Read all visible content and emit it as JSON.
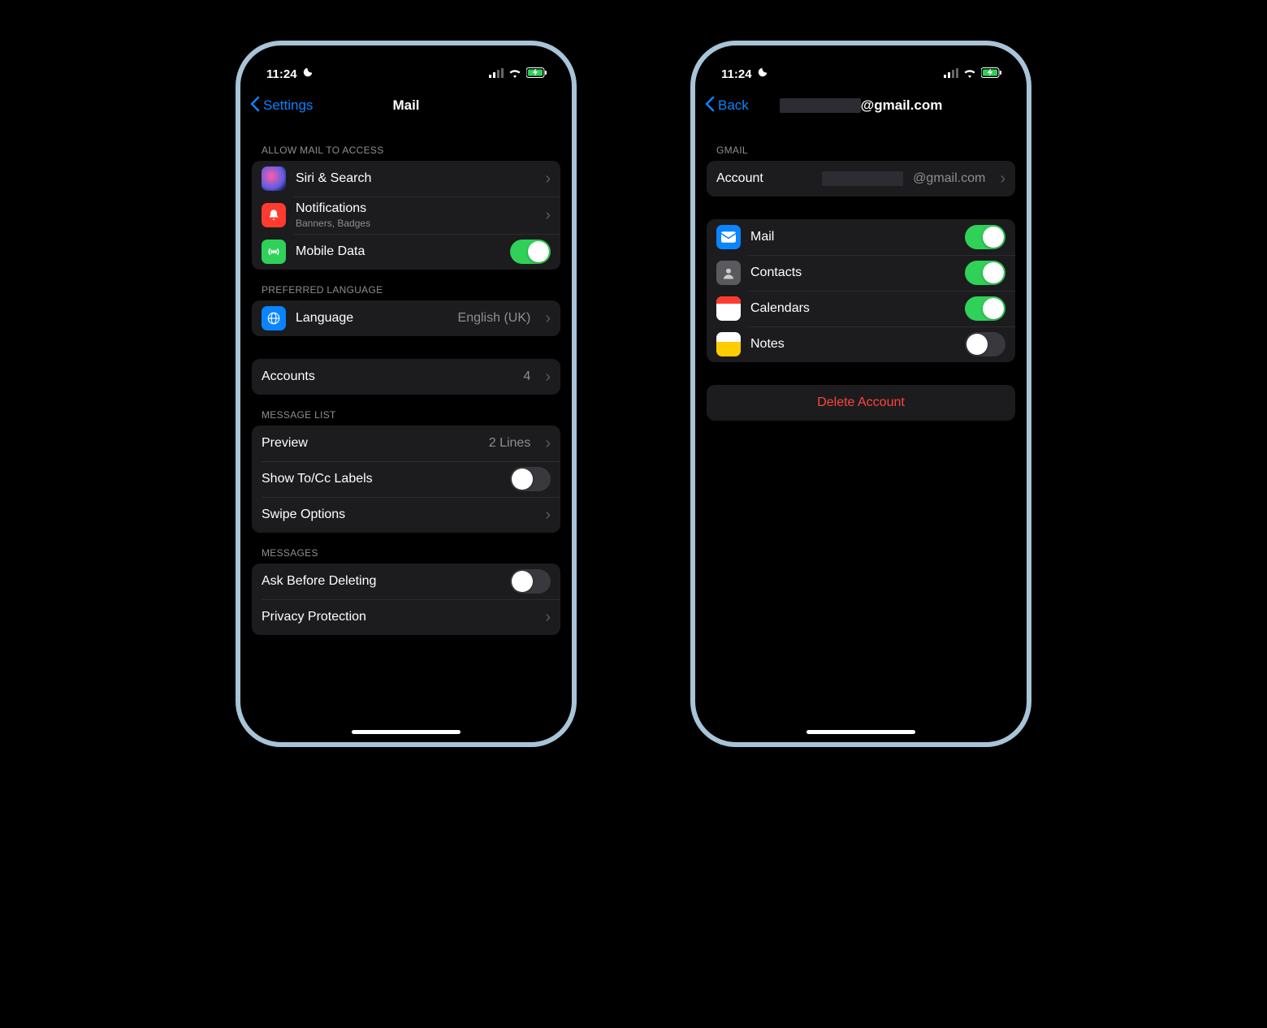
{
  "status": {
    "time": "11:24"
  },
  "left": {
    "back_label": "Settings",
    "title": "Mail",
    "sections": {
      "access_header": "ALLOW MAIL TO ACCESS",
      "siri_label": "Siri & Search",
      "notif_label": "Notifications",
      "notif_sub": "Banners, Badges",
      "mobile_label": "Mobile Data",
      "mobile_on": true,
      "pref_lang_header": "PREFERRED LANGUAGE",
      "lang_label": "Language",
      "lang_value": "English (UK)",
      "accounts_label": "Accounts",
      "accounts_count": "4",
      "msglist_header": "MESSAGE LIST",
      "preview_label": "Preview",
      "preview_value": "2 Lines",
      "showtocc_label": "Show To/Cc Labels",
      "showtocc_on": false,
      "swipe_label": "Swipe Options",
      "messages_header": "MESSAGES",
      "askdel_label": "Ask Before Deleting",
      "askdel_on": false,
      "privacy_label": "Privacy Protection"
    }
  },
  "right": {
    "back_label": "Back",
    "title_suffix": "@gmail.com",
    "gmail_header": "GMAIL",
    "account_label": "Account",
    "account_suffix": "@gmail.com",
    "services": {
      "mail_label": "Mail",
      "mail_on": true,
      "contacts_label": "Contacts",
      "contacts_on": true,
      "cal_label": "Calendars",
      "cal_on": true,
      "notes_label": "Notes",
      "notes_on": false
    },
    "delete_label": "Delete Account"
  }
}
